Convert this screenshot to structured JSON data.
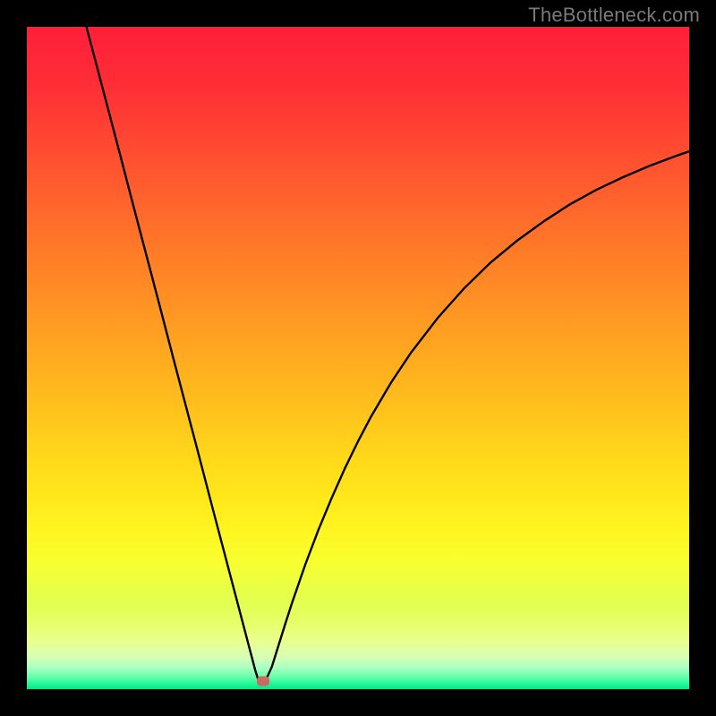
{
  "watermark": "TheBottleneck.com",
  "chart_data": {
    "type": "line",
    "title": "",
    "xlabel": "",
    "ylabel": "",
    "xlim": [
      0,
      100
    ],
    "ylim": [
      0,
      100
    ],
    "grid": false,
    "curve_x": [
      9,
      10,
      12,
      14,
      16,
      18,
      20,
      22,
      24,
      26,
      28,
      30,
      31,
      32,
      33,
      33.5,
      34,
      34.5,
      35,
      36,
      37,
      38,
      39,
      40,
      42,
      44,
      46,
      48,
      50,
      52,
      55,
      58,
      62,
      66,
      70,
      74,
      78,
      82,
      86,
      90,
      94,
      98,
      100
    ],
    "curve_y": [
      100,
      96.2,
      88.6,
      81.0,
      73.3,
      65.7,
      58.1,
      50.4,
      42.8,
      35.2,
      27.5,
      19.9,
      16.1,
      12.3,
      8.5,
      6.6,
      4.7,
      2.8,
      1.2,
      1.2,
      3.4,
      6.6,
      9.8,
      12.9,
      18.7,
      24.0,
      28.8,
      33.3,
      37.4,
      41.2,
      46.3,
      50.8,
      56.0,
      60.5,
      64.4,
      67.7,
      70.6,
      73.2,
      75.4,
      77.3,
      79.0,
      80.5,
      81.2
    ],
    "marker": {
      "x": 35.7,
      "y": 1.2
    },
    "gradient_stops": [
      {
        "pos": 0.0,
        "color": "#ff1f3a"
      },
      {
        "pos": 0.09,
        "color": "#ff2e36"
      },
      {
        "pos": 0.2,
        "color": "#ff5030"
      },
      {
        "pos": 0.32,
        "color": "#ff7529"
      },
      {
        "pos": 0.44,
        "color": "#ff9922"
      },
      {
        "pos": 0.56,
        "color": "#ffbc1d"
      },
      {
        "pos": 0.66,
        "color": "#ffdb1a"
      },
      {
        "pos": 0.75,
        "color": "#fff21e"
      },
      {
        "pos": 0.805,
        "color": "#f9ff2e"
      },
      {
        "pos": 0.845,
        "color": "#eaff44"
      },
      {
        "pos": 0.875,
        "color": "#e2ff53"
      },
      {
        "pos": 0.905,
        "color": "#e8ff6f"
      },
      {
        "pos": 0.93,
        "color": "#e8ff94"
      },
      {
        "pos": 0.952,
        "color": "#d6ffb5"
      },
      {
        "pos": 0.968,
        "color": "#a8ffc0"
      },
      {
        "pos": 0.982,
        "color": "#64ffaa"
      },
      {
        "pos": 0.992,
        "color": "#22f796"
      },
      {
        "pos": 1.0,
        "color": "#00e884"
      }
    ]
  }
}
